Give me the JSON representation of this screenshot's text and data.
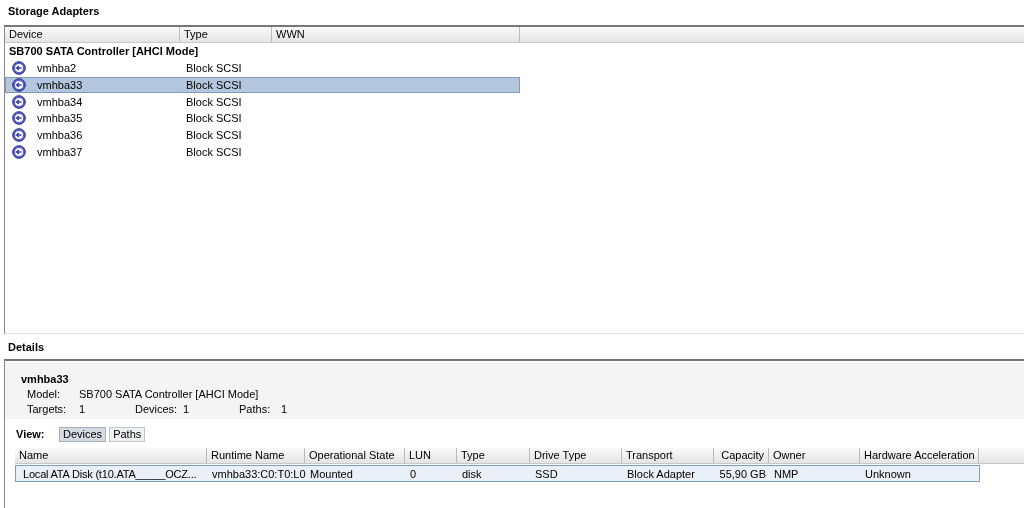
{
  "title": "Storage Adapters",
  "adapters": {
    "columns": [
      "Device",
      "Type",
      "WWN"
    ],
    "groups": [
      {
        "name": "SB700 SATA Controller [AHCI Mode]",
        "rows": [
          {
            "device": "vmhba2",
            "type": "Block SCSI",
            "selected": false
          },
          {
            "device": "vmhba33",
            "type": "Block SCSI",
            "selected": true
          },
          {
            "device": "vmhba34",
            "type": "Block SCSI",
            "selected": false
          },
          {
            "device": "vmhba35",
            "type": "Block SCSI",
            "selected": false
          },
          {
            "device": "vmhba36",
            "type": "Block SCSI",
            "selected": false
          },
          {
            "device": "vmhba37",
            "type": "Block SCSI",
            "selected": false
          }
        ]
      }
    ]
  },
  "details": {
    "title": "Details",
    "name": "vmhba33",
    "model_label": "Model:",
    "model": "SB700 SATA Controller [AHCI Mode]",
    "stats": [
      {
        "label": "Targets:",
        "value": "1"
      },
      {
        "label": "Devices:",
        "value": "1"
      },
      {
        "label": "Paths:",
        "value": "1"
      }
    ],
    "view_label": "View:",
    "views": [
      {
        "label": "Devices",
        "selected": true
      },
      {
        "label": "Paths",
        "selected": false
      }
    ],
    "columns": [
      "Name",
      "Runtime Name",
      "Operational State",
      "LUN",
      "Type",
      "Drive Type",
      "Transport",
      "Capacity",
      "Owner",
      "Hardware Acceleration"
    ],
    "rows": [
      {
        "cells": [
          "Local ATA Disk (t10.ATA_____OCZ...",
          "vmhba33:C0:T0:L0",
          "Mounted",
          "0",
          "disk",
          "SSD",
          "Block Adapter",
          "55,90 GB",
          "NMP",
          "Unknown"
        ],
        "selected": true
      }
    ]
  }
}
